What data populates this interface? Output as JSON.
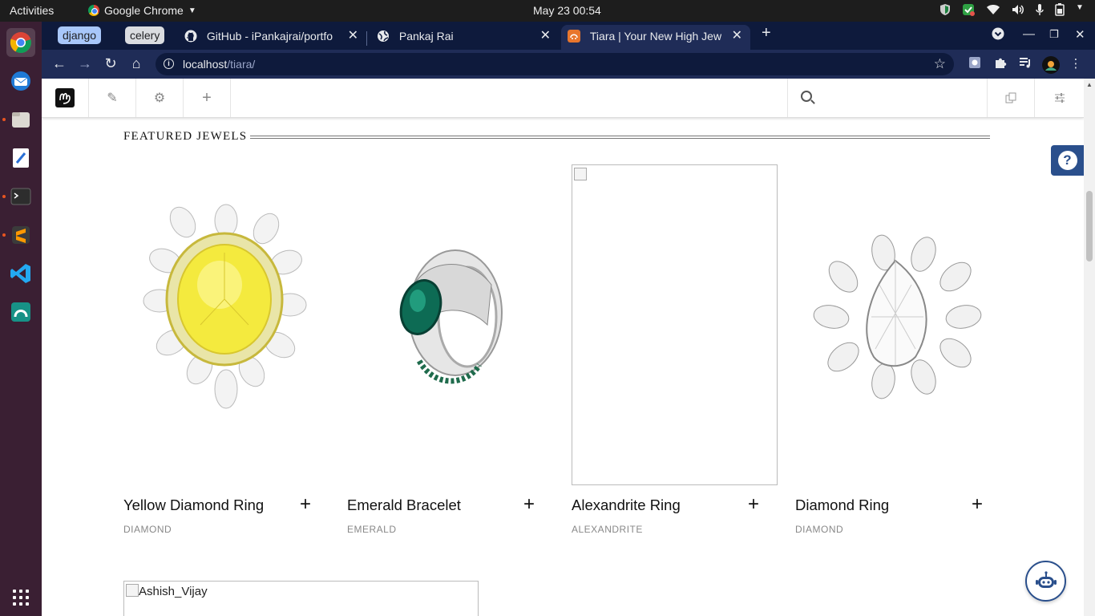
{
  "topbar": {
    "activities": "Activities",
    "app_name": "Google Chrome",
    "clock": "May 23  00:54"
  },
  "tab_groups": [
    {
      "label": "django",
      "color": "#a8c7fa"
    },
    {
      "label": "celery",
      "color": "#dadce0"
    }
  ],
  "tabs": [
    {
      "title": "GitHub - iPankajrai/portfo",
      "icon": "github-icon"
    },
    {
      "title": "Pankaj Rai",
      "icon": "globe-icon"
    },
    {
      "title": "Tiara | Your New High Jew",
      "icon": "django-favicon",
      "active": true
    }
  ],
  "address_bar": {
    "host": "localhost",
    "path": "/tiara/"
  },
  "cms_toolbar": {
    "search_placeholder": ""
  },
  "section": {
    "title": "FEATURED JEWELS"
  },
  "products": [
    {
      "name": "Yellow Diamond Ring",
      "category": "DIAMOND",
      "image": "yellow-diamond-ring"
    },
    {
      "name": "Emerald Bracelet",
      "category": "EMERALD",
      "image": "emerald-ring"
    },
    {
      "name": "Alexandrite Ring",
      "category": "ALEXANDRITE",
      "image": "broken"
    },
    {
      "name": "Diamond Ring",
      "category": "DIAMOND",
      "image": "diamond-cluster-ring"
    }
  ],
  "broken_image_alt": "Ashish_Vijay",
  "colors": {
    "tabstrip": "#0e1a3c",
    "toolbar": "#1f2c57",
    "help_button": "#2a4f8c"
  }
}
